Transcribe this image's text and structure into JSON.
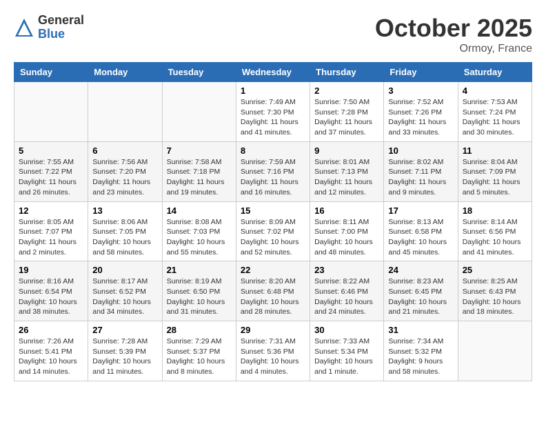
{
  "logo": {
    "general": "General",
    "blue": "Blue"
  },
  "header": {
    "month": "October 2025",
    "location": "Ormoy, France"
  },
  "days_of_week": [
    "Sunday",
    "Monday",
    "Tuesday",
    "Wednesday",
    "Thursday",
    "Friday",
    "Saturday"
  ],
  "weeks": [
    [
      {
        "day": "",
        "info": ""
      },
      {
        "day": "",
        "info": ""
      },
      {
        "day": "",
        "info": ""
      },
      {
        "day": "1",
        "info": "Sunrise: 7:49 AM\nSunset: 7:30 PM\nDaylight: 11 hours\nand 41 minutes."
      },
      {
        "day": "2",
        "info": "Sunrise: 7:50 AM\nSunset: 7:28 PM\nDaylight: 11 hours\nand 37 minutes."
      },
      {
        "day": "3",
        "info": "Sunrise: 7:52 AM\nSunset: 7:26 PM\nDaylight: 11 hours\nand 33 minutes."
      },
      {
        "day": "4",
        "info": "Sunrise: 7:53 AM\nSunset: 7:24 PM\nDaylight: 11 hours\nand 30 minutes."
      }
    ],
    [
      {
        "day": "5",
        "info": "Sunrise: 7:55 AM\nSunset: 7:22 PM\nDaylight: 11 hours\nand 26 minutes."
      },
      {
        "day": "6",
        "info": "Sunrise: 7:56 AM\nSunset: 7:20 PM\nDaylight: 11 hours\nand 23 minutes."
      },
      {
        "day": "7",
        "info": "Sunrise: 7:58 AM\nSunset: 7:18 PM\nDaylight: 11 hours\nand 19 minutes."
      },
      {
        "day": "8",
        "info": "Sunrise: 7:59 AM\nSunset: 7:16 PM\nDaylight: 11 hours\nand 16 minutes."
      },
      {
        "day": "9",
        "info": "Sunrise: 8:01 AM\nSunset: 7:13 PM\nDaylight: 11 hours\nand 12 minutes."
      },
      {
        "day": "10",
        "info": "Sunrise: 8:02 AM\nSunset: 7:11 PM\nDaylight: 11 hours\nand 9 minutes."
      },
      {
        "day": "11",
        "info": "Sunrise: 8:04 AM\nSunset: 7:09 PM\nDaylight: 11 hours\nand 5 minutes."
      }
    ],
    [
      {
        "day": "12",
        "info": "Sunrise: 8:05 AM\nSunset: 7:07 PM\nDaylight: 11 hours\nand 2 minutes."
      },
      {
        "day": "13",
        "info": "Sunrise: 8:06 AM\nSunset: 7:05 PM\nDaylight: 10 hours\nand 58 minutes."
      },
      {
        "day": "14",
        "info": "Sunrise: 8:08 AM\nSunset: 7:03 PM\nDaylight: 10 hours\nand 55 minutes."
      },
      {
        "day": "15",
        "info": "Sunrise: 8:09 AM\nSunset: 7:02 PM\nDaylight: 10 hours\nand 52 minutes."
      },
      {
        "day": "16",
        "info": "Sunrise: 8:11 AM\nSunset: 7:00 PM\nDaylight: 10 hours\nand 48 minutes."
      },
      {
        "day": "17",
        "info": "Sunrise: 8:13 AM\nSunset: 6:58 PM\nDaylight: 10 hours\nand 45 minutes."
      },
      {
        "day": "18",
        "info": "Sunrise: 8:14 AM\nSunset: 6:56 PM\nDaylight: 10 hours\nand 41 minutes."
      }
    ],
    [
      {
        "day": "19",
        "info": "Sunrise: 8:16 AM\nSunset: 6:54 PM\nDaylight: 10 hours\nand 38 minutes."
      },
      {
        "day": "20",
        "info": "Sunrise: 8:17 AM\nSunset: 6:52 PM\nDaylight: 10 hours\nand 34 minutes."
      },
      {
        "day": "21",
        "info": "Sunrise: 8:19 AM\nSunset: 6:50 PM\nDaylight: 10 hours\nand 31 minutes."
      },
      {
        "day": "22",
        "info": "Sunrise: 8:20 AM\nSunset: 6:48 PM\nDaylight: 10 hours\nand 28 minutes."
      },
      {
        "day": "23",
        "info": "Sunrise: 8:22 AM\nSunset: 6:46 PM\nDaylight: 10 hours\nand 24 minutes."
      },
      {
        "day": "24",
        "info": "Sunrise: 8:23 AM\nSunset: 6:45 PM\nDaylight: 10 hours\nand 21 minutes."
      },
      {
        "day": "25",
        "info": "Sunrise: 8:25 AM\nSunset: 6:43 PM\nDaylight: 10 hours\nand 18 minutes."
      }
    ],
    [
      {
        "day": "26",
        "info": "Sunrise: 7:26 AM\nSunset: 5:41 PM\nDaylight: 10 hours\nand 14 minutes."
      },
      {
        "day": "27",
        "info": "Sunrise: 7:28 AM\nSunset: 5:39 PM\nDaylight: 10 hours\nand 11 minutes."
      },
      {
        "day": "28",
        "info": "Sunrise: 7:29 AM\nSunset: 5:37 PM\nDaylight: 10 hours\nand 8 minutes."
      },
      {
        "day": "29",
        "info": "Sunrise: 7:31 AM\nSunset: 5:36 PM\nDaylight: 10 hours\nand 4 minutes."
      },
      {
        "day": "30",
        "info": "Sunrise: 7:33 AM\nSunset: 5:34 PM\nDaylight: 10 hours\nand 1 minute."
      },
      {
        "day": "31",
        "info": "Sunrise: 7:34 AM\nSunset: 5:32 PM\nDaylight: 9 hours\nand 58 minutes."
      },
      {
        "day": "",
        "info": ""
      }
    ]
  ]
}
